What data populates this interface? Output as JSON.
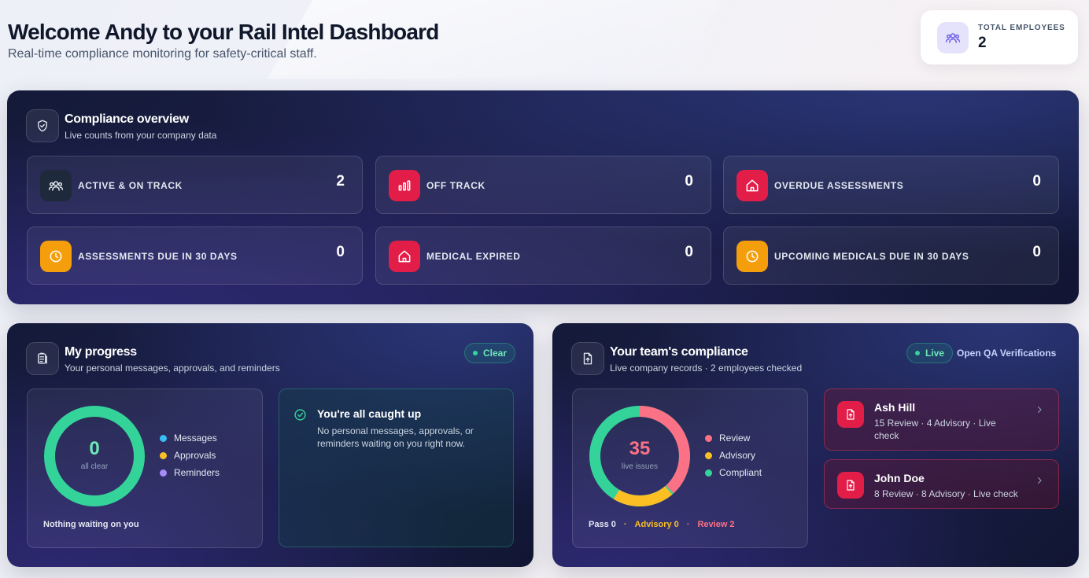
{
  "header": {
    "title": "Welcome Andy to your Rail Intel Dashboard",
    "subtitle": "Real-time compliance monitoring for safety-critical staff."
  },
  "total_employees": {
    "label": "TOTAL EMPLOYEES",
    "value": "2",
    "icon": "users-icon"
  },
  "overview": {
    "title": "Compliance overview",
    "subtitle": "Live counts from your company data",
    "icon": "shield-check-icon",
    "stats": [
      {
        "label": "ACTIVE & ON TRACK",
        "value": "2",
        "icon": "users-icon",
        "color": "#1e293b"
      },
      {
        "label": "OFF TRACK",
        "value": "0",
        "icon": "bar-chart-icon",
        "color": "#e11d48"
      },
      {
        "label": "OVERDUE ASSESSMENTS",
        "value": "0",
        "icon": "home-icon",
        "color": "#e11d48"
      },
      {
        "label": "ASSESSMENTS DUE IN 30 DAYS",
        "value": "0",
        "icon": "clock-icon",
        "color": "#f59e0b"
      },
      {
        "label": "MEDICAL EXPIRED",
        "value": "0",
        "icon": "home-icon",
        "color": "#e11d48"
      },
      {
        "label": "UPCOMING MEDICALS DUE IN 30 DAYS",
        "value": "0",
        "icon": "clock-icon",
        "color": "#f59e0b"
      }
    ]
  },
  "progress": {
    "title": "My progress",
    "subtitle": "Your personal messages, approvals, and reminders",
    "badge": "Clear",
    "donut_value": "0",
    "donut_caption": "all clear",
    "legend": [
      {
        "label": "Messages",
        "color": "#38bdf8"
      },
      {
        "label": "Approvals",
        "color": "#fbbf24"
      },
      {
        "label": "Reminders",
        "color": "#a78bfa"
      }
    ],
    "footer": "Nothing waiting on you",
    "caught_up_title": "You're all caught up",
    "caught_up_text": "No personal messages, approvals, or reminders waiting on you right now."
  },
  "team": {
    "title": "Your team's compliance",
    "subtitle": "Live company records · 2 employees checked",
    "badge": "Live",
    "link": "Open QA Verifications",
    "donut_value": "35",
    "donut_caption": "live issues",
    "legend": [
      {
        "label": "Review",
        "color": "#fb7185"
      },
      {
        "label": "Advisory",
        "color": "#fbbf24"
      },
      {
        "label": "Compliant",
        "color": "#34d399"
      }
    ],
    "segments": {
      "review": 23,
      "advisory": 12,
      "compliant_ring": true
    },
    "summary": {
      "pass": "Pass 0",
      "advisory": "Advisory 0",
      "review": "Review 2",
      "sep": "·"
    },
    "people": [
      {
        "name": "Ash Hill",
        "meta": "15 Review · 4 Advisory · Live check"
      },
      {
        "name": "John Doe",
        "meta": "8 Review · 8 Advisory · Live check"
      }
    ]
  }
}
